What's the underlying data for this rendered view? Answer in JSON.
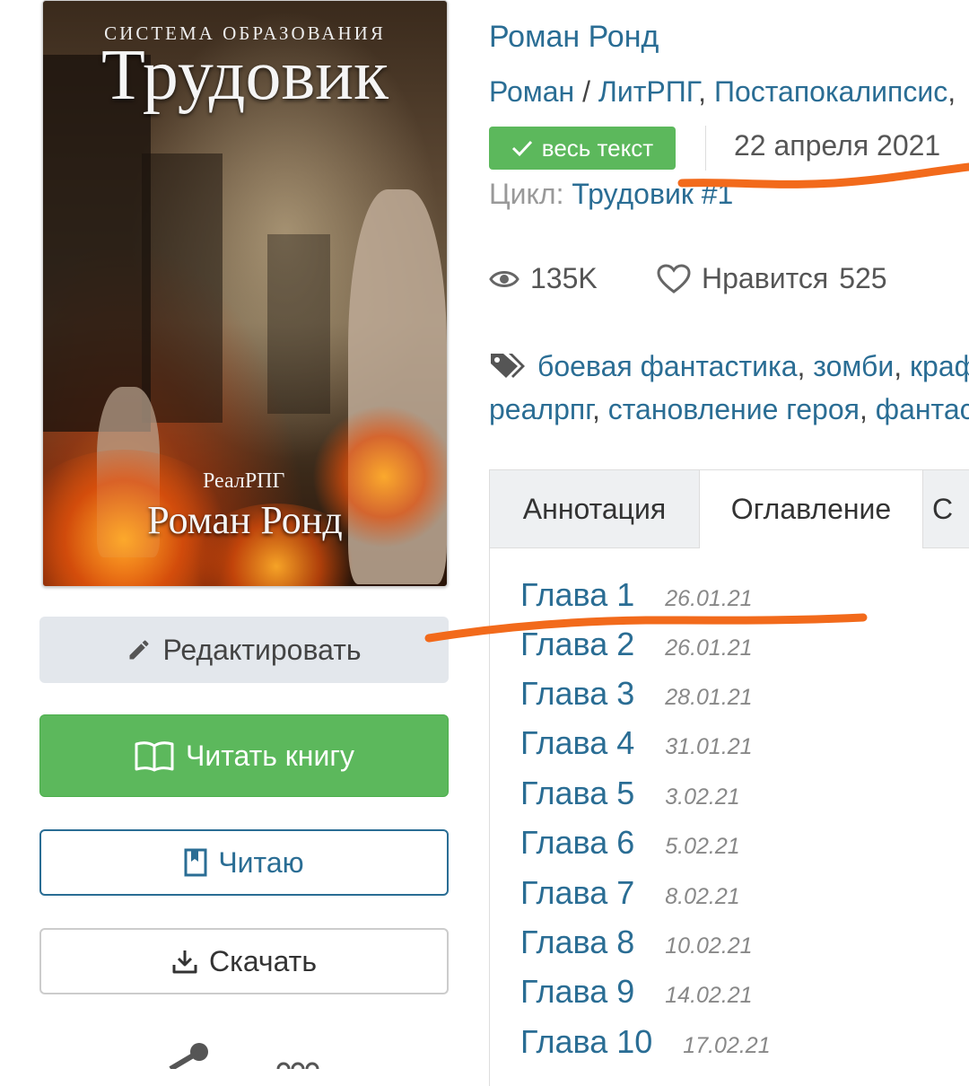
{
  "cover": {
    "series": "СИСТЕМА ОБРАЗОВАНИЯ",
    "title": "Трудовик",
    "genre": "РеалРПГ",
    "author": "Роман Ронд"
  },
  "actions": {
    "edit": "Редактировать",
    "read_book": "Читать книгу",
    "reading": "Читаю",
    "download": "Скачать"
  },
  "book": {
    "author": "Роман Ронд",
    "genres": [
      "Роман",
      "ЛитРПГ",
      "Постапокалипсис"
    ],
    "genre_sep": "/",
    "status_badge": "весь текст",
    "publish_date": "22 апреля 2021",
    "cycle_label": "Цикл:",
    "cycle_name": "Трудовик #1",
    "views": "135K",
    "likes_label": "Нравится",
    "likes_count": "525",
    "tags_line1": [
      "боевая фантастика",
      "зомби",
      "краф"
    ],
    "tags_line2": [
      "реалрпг",
      "становление героя",
      "фантас"
    ]
  },
  "tabs": [
    "Аннотация",
    "Оглавление",
    "С"
  ],
  "chapters": [
    {
      "title": "Глава 1",
      "date": "26.01.21"
    },
    {
      "title": "Глава 2",
      "date": "26.01.21"
    },
    {
      "title": "Глава 3",
      "date": "28.01.21"
    },
    {
      "title": "Глава 4",
      "date": "31.01.21"
    },
    {
      "title": "Глава 5",
      "date": "3.02.21"
    },
    {
      "title": "Глава 6",
      "date": "5.02.21"
    },
    {
      "title": "Глава 7",
      "date": "8.02.21"
    },
    {
      "title": "Глава 8",
      "date": "10.02.21"
    },
    {
      "title": "Глава 9",
      "date": "14.02.21"
    },
    {
      "title": "Глава 10",
      "date": "17.02.21"
    }
  ],
  "colors": {
    "link": "#2a6d94",
    "success": "#5cb85c",
    "annotation": "#f26a1b"
  },
  "icons": [
    "pencil-icon",
    "open-book-icon",
    "bookmark-icon",
    "download-icon",
    "check-icon",
    "eye-icon",
    "heart-icon",
    "tag-icon",
    "share-icon",
    "more-icon"
  ]
}
